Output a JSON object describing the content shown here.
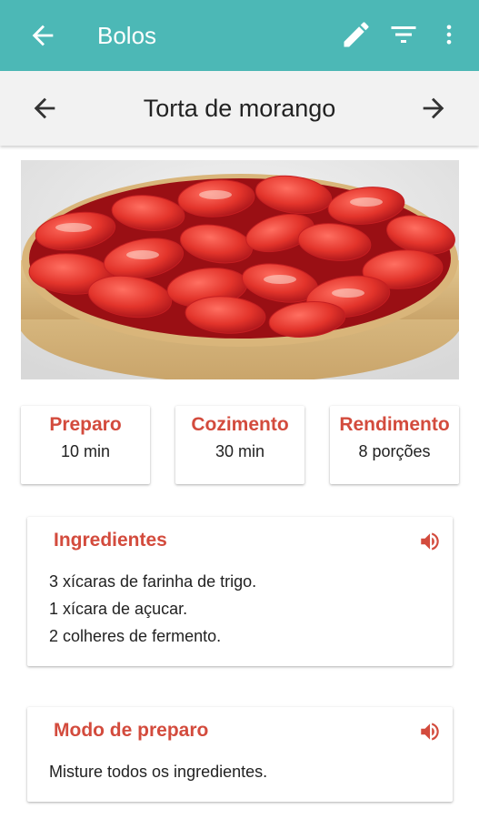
{
  "appbar": {
    "title": "Bolos",
    "icons": [
      "arrow-back-icon",
      "pencil-icon",
      "filter-icon",
      "more-vert-icon"
    ],
    "color": "#4cb8b6"
  },
  "navigator": {
    "title": "Torta de morango",
    "icons": [
      "arrow-left-icon",
      "arrow-right-icon"
    ]
  },
  "photo": {
    "subject": "strawberry tart"
  },
  "info": [
    {
      "label": "Preparo",
      "value": "10 min"
    },
    {
      "label": "Cozimento",
      "value": "30 min"
    },
    {
      "label": "Rendimento",
      "value": "8 porções"
    }
  ],
  "ingredients": {
    "title": "Ingredientes",
    "items": [
      "3 xícaras de farinha de trigo.",
      "1 xícara de açucar.",
      "2 colheres de fermento."
    ]
  },
  "method": {
    "title": "Modo de preparo",
    "items": [
      "Misture todos os ingredientes."
    ]
  },
  "colors": {
    "accent": "#d34b3d",
    "toolbar": "#4cb8b6"
  }
}
